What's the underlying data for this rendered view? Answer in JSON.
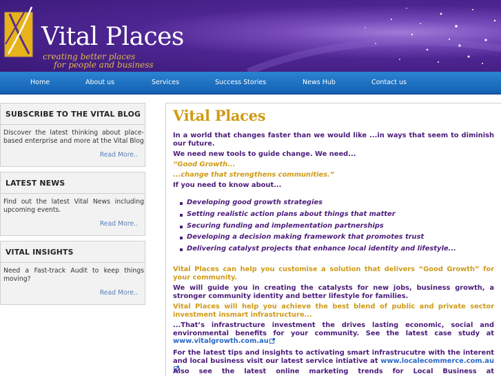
{
  "header": {
    "brand_name": "Vital Places",
    "tagline_line1": "creating better places",
    "tagline_line2": "for people and business"
  },
  "nav": [
    "Home",
    "About us",
    "Services",
    "Success Stories",
    "News Hub",
    "Contact us"
  ],
  "sidebar": {
    "boxes": [
      {
        "title": "SUBSCRIBE TO THE VITAL BLOG",
        "text": "Discover the latest thinking about place-based enterprise and more at the Vital Blog",
        "more": "Read More.."
      },
      {
        "title": "LATEST NEWS",
        "text": "Find out the latest Vital News including upcoming events.",
        "more": "Read More.."
      },
      {
        "title": "VITAL INSIGHTS",
        "text": "Need a Fast-track Audit to keep things moving?",
        "more": "Read More.."
      }
    ]
  },
  "main": {
    "title": "Vital Places",
    "intro": "In a world that changes faster than we would like  ...in ways that seem to diminish our future.",
    "need_tools": "We need new tools to guide change. We need...",
    "good_growth": "“Good Growth...",
    "change_that": "...change that strengthens communities.”",
    "if_you_need": "If you need to know about...",
    "bullets": [
      "Developing good growth strategies",
      "Setting realistic action plans about things that matter",
      "Securing funding and implementation partnerships",
      "Developing a decision making framework that promotes trust",
      "Delivering catalyst projects that enhance local identity and lifestyle..."
    ],
    "help_customise": "Vital Places can help you customise a solution that delivers “Good Growth” for your community.",
    "guide_you": "We will guide you in creating the catalysts for new jobs, business growth, a stronger community identity and better lifestyle for families.",
    "best_blend": "Vital Places will help you achieve the best blend of public and private sector investment insmart infrastructure...",
    "thats_text": "...That’s infrastructure investment the drives lasting economic, social and environmental benefits for your community. See the latest case study at ",
    "thats_link": "www.vitalgrowth.com.au",
    "latest_tips_text": "For the latest tips and insights to activating smart infrastrucutre with the interent and local business visit our latest service intiative at ",
    "latest_tips_link": "www.localecommerce.com.au",
    "also_see": "Also see the latest online marketing trends for Local Business at"
  },
  "colors": {
    "accent_gold": "#cf9a16",
    "text_purple": "#4c1c7a",
    "nav_blue": "#1e72c4",
    "link_blue": "#2968c8"
  }
}
